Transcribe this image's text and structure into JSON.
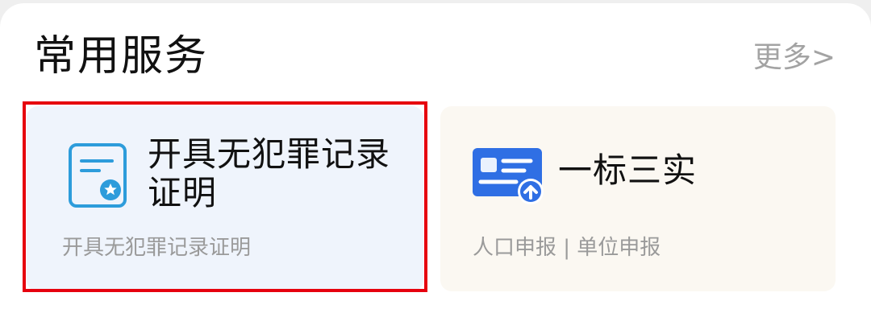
{
  "section": {
    "title": "常用服务",
    "more_label": "更多>"
  },
  "cards": [
    {
      "title": "开具无犯罪记录证明",
      "subtitle": "开具无犯罪记录证明",
      "icon": "certificate-icon",
      "highlighted": true,
      "accent": "#2d9cdb"
    },
    {
      "title": "一标三实",
      "subtitle": "人口申报 | 单位申报",
      "icon": "id-card-upload-icon",
      "highlighted": false,
      "accent": "#2f6fe4"
    }
  ],
  "colors": {
    "highlight_border": "#e6000e",
    "card_left_bg": "#eff4fc",
    "card_right_bg": "#fbf8f2"
  }
}
